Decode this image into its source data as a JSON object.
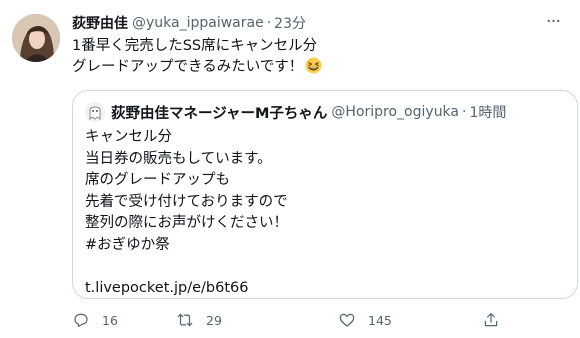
{
  "tweet": {
    "display_name": "荻野由佳",
    "handle": "@yuka_ippaiwarae",
    "separator": "·",
    "time": "23分",
    "text_lines": [
      "1番早く完売したSS席にキャンセル分",
      "グレードアップできるみたいです！"
    ],
    "emoji": "grinning-squinting-face"
  },
  "quote": {
    "display_name": "荻野由佳マネージャーM子ちゃん",
    "handle": "@Horipro_ogiyuka",
    "separator": "·",
    "time": "1時間",
    "text_lines": [
      "キャンセル分",
      "当日券の販売もしています。",
      "席のグレードアップも",
      "先着で受け付けておりますので",
      "整列の際にお声がけください！",
      " #おぎゆか祭"
    ],
    "link": "t.livepocket.jp/e/b6t66"
  },
  "actions": {
    "reply_count": "16",
    "retweet_count": "29",
    "like_count": "145"
  },
  "colors": {
    "text": "#0f1419",
    "secondary": "#536471",
    "border": "#cfd9de"
  }
}
